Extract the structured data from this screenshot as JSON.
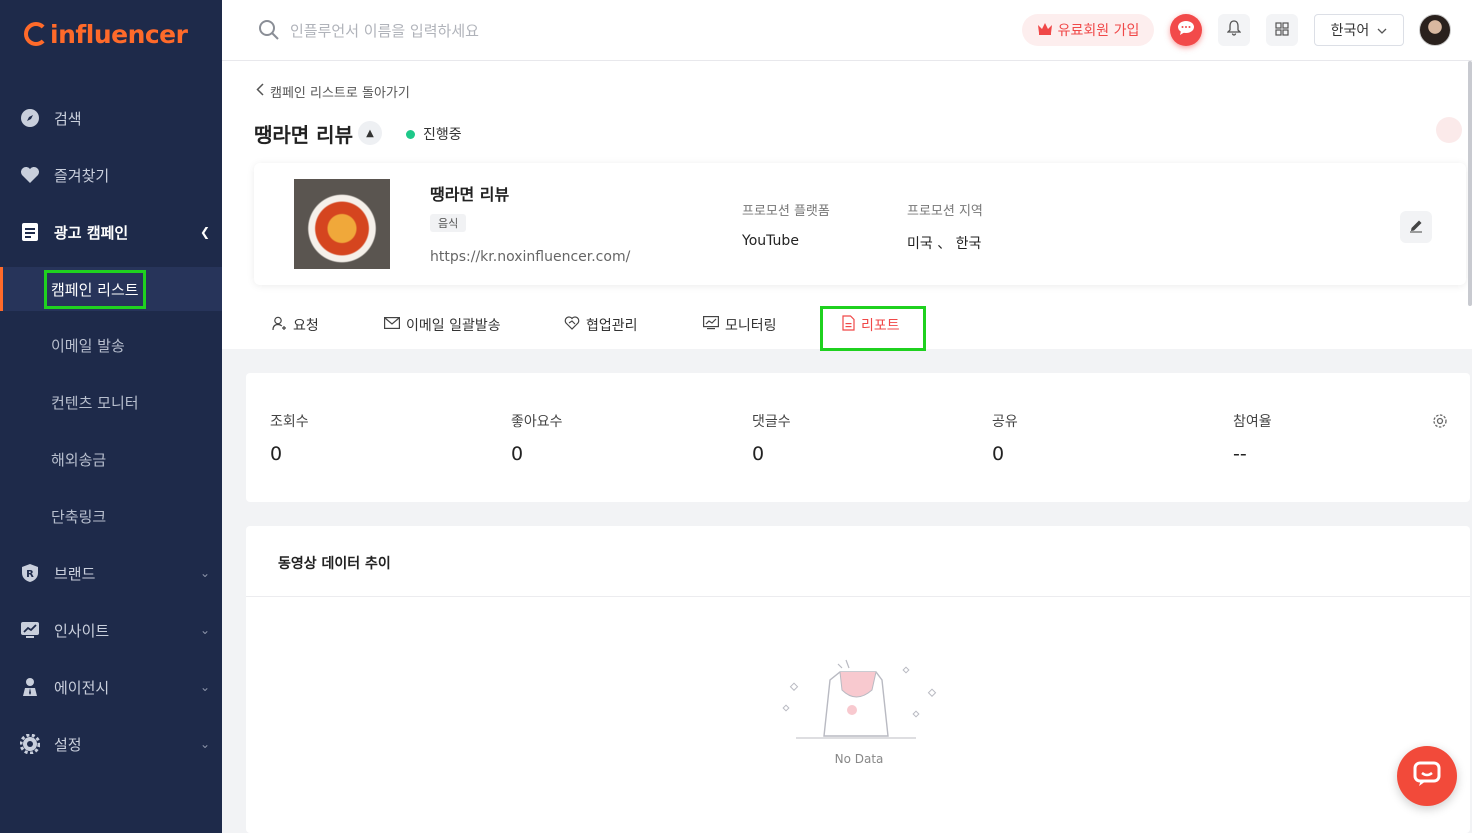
{
  "brand": {
    "logo_text": "influencer"
  },
  "sidebar": {
    "items": [
      {
        "label": "검색"
      },
      {
        "label": "즐겨찾기"
      },
      {
        "label": "광고 캠페인"
      },
      {
        "label": "브랜드"
      },
      {
        "label": "인사이트"
      },
      {
        "label": "에이전시"
      },
      {
        "label": "설정"
      }
    ],
    "sub_items": [
      {
        "label": "캠페인 리스트"
      },
      {
        "label": "이메일 발송"
      },
      {
        "label": "컨텐츠 모니터"
      },
      {
        "label": "해외송금"
      },
      {
        "label": "단축링크"
      }
    ]
  },
  "topbar": {
    "search_placeholder": "인플루언서 이름을 입력하세요",
    "premium_label": "유료회원 가입",
    "language": "한국어"
  },
  "page": {
    "back_label": "캠페인 리스트로 돌아가기",
    "title": "땡라면 리뷰",
    "status": "진행중"
  },
  "campaign": {
    "name": "땡라면 리뷰",
    "tag": "음식",
    "url": "https://kr.noxinfluencer.com/",
    "platform_label": "프로모션 플랫폼",
    "platform_value": "YouTube",
    "region_label": "프로모션 지역",
    "region_value": "미국 、 한국"
  },
  "tabs": [
    {
      "label": "요청"
    },
    {
      "label": "이메일 일괄발송"
    },
    {
      "label": "협업관리"
    },
    {
      "label": "모니터링"
    },
    {
      "label": "리포트"
    }
  ],
  "stats": [
    {
      "label": "조회수",
      "value": "0"
    },
    {
      "label": "좋아요수",
      "value": "0"
    },
    {
      "label": "댓글수",
      "value": "0"
    },
    {
      "label": "공유",
      "value": "0"
    },
    {
      "label": "참여율",
      "value": "--"
    }
  ],
  "trend": {
    "title": "동영상 데이터 추이",
    "empty_label": "No Data"
  },
  "colors": {
    "sidebar_bg": "#1e2a4a",
    "accent": "#ff6a2a",
    "active_red": "#f04848",
    "status_green": "#1ec889",
    "highlight_green": "#1fd11f"
  }
}
